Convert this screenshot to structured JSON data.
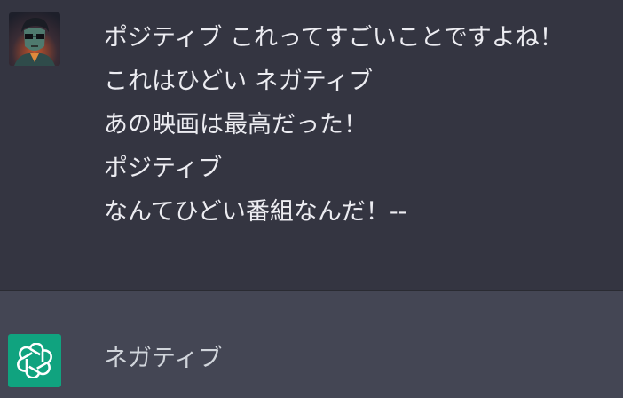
{
  "user_message": {
    "lines": [
      "ポジティブ これってすごいことですよね！",
      "これはひどい ネガティブ",
      "あの映画は最高だった！",
      "ポジティブ",
      "なんてひどい番組なんだ！--"
    ]
  },
  "assistant_message": {
    "text": "ネガティブ"
  },
  "avatars": {
    "user_icon": "user-portrait-icon",
    "assistant_icon": "openai-logo-icon",
    "assistant_color": "#10a37f"
  },
  "colors": {
    "user_bg": "#343541",
    "assistant_bg": "#444654",
    "text": "#ececf1"
  }
}
